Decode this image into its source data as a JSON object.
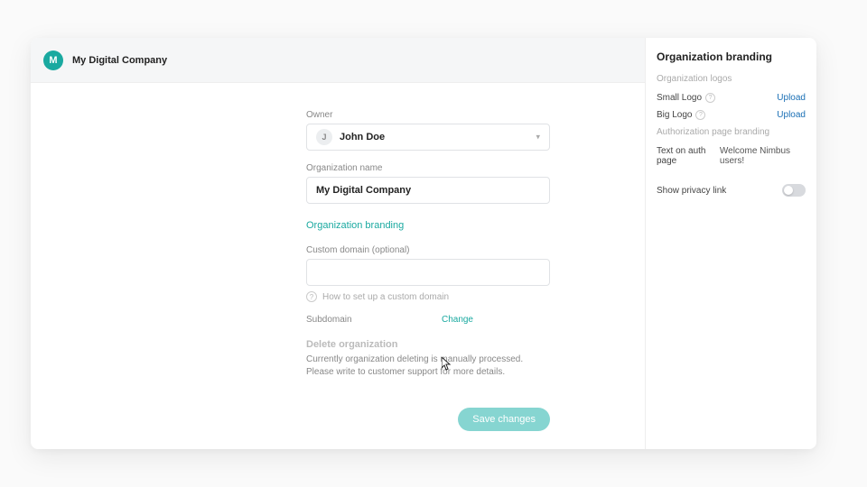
{
  "header": {
    "avatar_letter": "M",
    "org_title": "My Digital Company"
  },
  "form": {
    "owner_label": "Owner",
    "owner_initial": "J",
    "owner_name": "John Doe",
    "org_name_label": "Organization name",
    "org_name_value": "My Digital Company",
    "branding_link": "Organization branding",
    "custom_domain_label": "Custom domain (optional)",
    "custom_domain_value": "",
    "custom_domain_help": "How to set up a custom domain",
    "subdomain_label": "Subdomain",
    "change_link": "Change",
    "delete_heading": "Delete organization",
    "delete_text_line1": "Currently organization deleting is manually processed.",
    "delete_text_line2": "Please write to customer support for more details.",
    "save_button": "Save changes"
  },
  "side": {
    "title": "Organization branding",
    "logos_subheading": "Organization logos",
    "small_logo_label": "Small Logo",
    "big_logo_label": "Big Logo",
    "upload_label": "Upload",
    "auth_subheading": "Authorization page branding",
    "text_on_auth_label": "Text on auth page",
    "text_on_auth_value": "Welcome Nimbus users!",
    "show_privacy_label": "Show privacy link"
  }
}
